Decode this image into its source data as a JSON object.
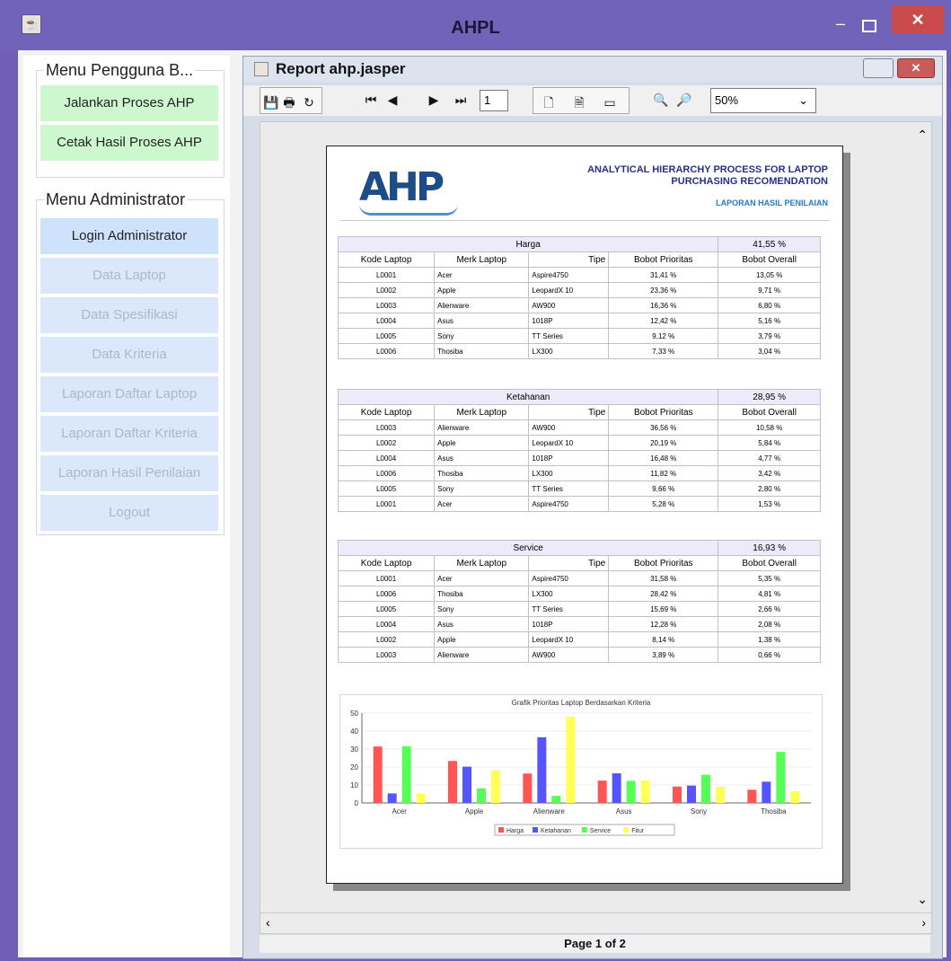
{
  "window": {
    "title": "AHPL",
    "minimize_glyph": "–",
    "close_glyph": "✕"
  },
  "sidebar": {
    "user_group": {
      "title": "Menu Pengguna B...",
      "items": [
        {
          "label": "Jalankan Proses AHP"
        },
        {
          "label": "Cetak Hasil Proses AHP"
        }
      ]
    },
    "admin_group": {
      "title": "Menu Administrator",
      "items": [
        {
          "label": "Login Administrator"
        },
        {
          "label": "Data Laptop"
        },
        {
          "label": "Data Spesifikasi"
        },
        {
          "label": "Data Kriteria"
        },
        {
          "label": "Laporan Daftar Laptop"
        },
        {
          "label": "Laporan Daftar Kriteria"
        },
        {
          "label": "Laporan Hasil Penilaian"
        },
        {
          "label": "Logout"
        }
      ]
    }
  },
  "viewer": {
    "title": "Report ahp.jasper",
    "page_input": "1",
    "zoom": "50%",
    "status": "Page 1 of 2",
    "icons": [
      "save-icon",
      "print-icon",
      "reload-icon",
      "first-page-icon",
      "prev-page-icon",
      "next-page-icon",
      "last-page-icon",
      "actual-size-icon",
      "fit-page-icon",
      "fit-width-icon",
      "zoom-in-icon",
      "zoom-out-icon"
    ]
  },
  "report": {
    "logo_text": "AHP",
    "heading_line1": "ANALYTICAL HIERARCHY PROCESS FOR LAPTOP",
    "heading_line2": "PURCHASING RECOMENDATION",
    "heading_line3": "LAPORAN HASIL PENILAIAN",
    "columns": [
      "Kode Laptop",
      "Merk Laptop",
      "Tipe",
      "Bobot Prioritas",
      "Bobot Overall"
    ],
    "tables": [
      {
        "criterion": "Harga",
        "weight": "41,55 %",
        "rows": [
          [
            "L0001",
            "Acer",
            "Aspire4750",
            "31,41 %",
            "13,05 %"
          ],
          [
            "L0002",
            "Apple",
            "LeopardX 10",
            "23,36 %",
            "9,71 %"
          ],
          [
            "L0003",
            "Alienware",
            "AW900",
            "16,36 %",
            "6,80 %"
          ],
          [
            "L0004",
            "Asus",
            "1018P",
            "12,42 %",
            "5,16 %"
          ],
          [
            "L0005",
            "Sony",
            "TT Series",
            "9,12 %",
            "3,79 %"
          ],
          [
            "L0006",
            "Thosiba",
            "LX300",
            "7,33 %",
            "3,04 %"
          ]
        ]
      },
      {
        "criterion": "Ketahanan",
        "weight": "28,95 %",
        "rows": [
          [
            "L0003",
            "Alienware",
            "AW900",
            "36,56 %",
            "10,58 %"
          ],
          [
            "L0002",
            "Apple",
            "LeopardX 10",
            "20,19 %",
            "5,84 %"
          ],
          [
            "L0004",
            "Asus",
            "1018P",
            "16,48 %",
            "4,77 %"
          ],
          [
            "L0006",
            "Thosiba",
            "LX300",
            "11,82 %",
            "3,42 %"
          ],
          [
            "L0005",
            "Sony",
            "TT Series",
            "9,66 %",
            "2,80 %"
          ],
          [
            "L0001",
            "Acer",
            "Aspire4750",
            "5,28 %",
            "1,53 %"
          ]
        ]
      },
      {
        "criterion": "Service",
        "weight": "16,93 %",
        "rows": [
          [
            "L0001",
            "Acer",
            "Aspire4750",
            "31,58 %",
            "5,35 %"
          ],
          [
            "L0006",
            "Thosiba",
            "LX300",
            "28,42 %",
            "4,81 %"
          ],
          [
            "L0005",
            "Sony",
            "TT Series",
            "15,69 %",
            "2,66 %"
          ],
          [
            "L0004",
            "Asus",
            "1018P",
            "12,28 %",
            "2,08 %"
          ],
          [
            "L0002",
            "Apple",
            "LeopardX 10",
            "8,14 %",
            "1,38 %"
          ],
          [
            "L0003",
            "Alienware",
            "AW900",
            "3,89 %",
            "0,66 %"
          ]
        ]
      }
    ]
  },
  "colors": {
    "harga": "#ff5555",
    "ketahanan": "#5555ff",
    "service": "#55ff55",
    "fitur": "#ffff55"
  },
  "chart_data": {
    "type": "bar",
    "title": "Grafik Prioritas Laptop Berdasarkan Kriteria",
    "categories": [
      "Acer",
      "Apple",
      "Alienware",
      "Asus",
      "Sony",
      "Thosiba"
    ],
    "series": [
      {
        "name": "Harga",
        "values": [
          31.41,
          23.36,
          16.36,
          12.42,
          9.12,
          7.33
        ]
      },
      {
        "name": "Ketahanan",
        "values": [
          5.28,
          20.19,
          36.56,
          16.48,
          9.66,
          11.82
        ]
      },
      {
        "name": "Service",
        "values": [
          31.58,
          8.14,
          3.89,
          12.28,
          15.69,
          28.42
        ]
      },
      {
        "name": "Fitur",
        "values": [
          5,
          18,
          48,
          12.5,
          9,
          6.5
        ]
      }
    ],
    "ylim": [
      0,
      50
    ],
    "yticks": [
      "0",
      "10",
      "20",
      "30",
      "40",
      "50"
    ],
    "legend": "bottom"
  }
}
